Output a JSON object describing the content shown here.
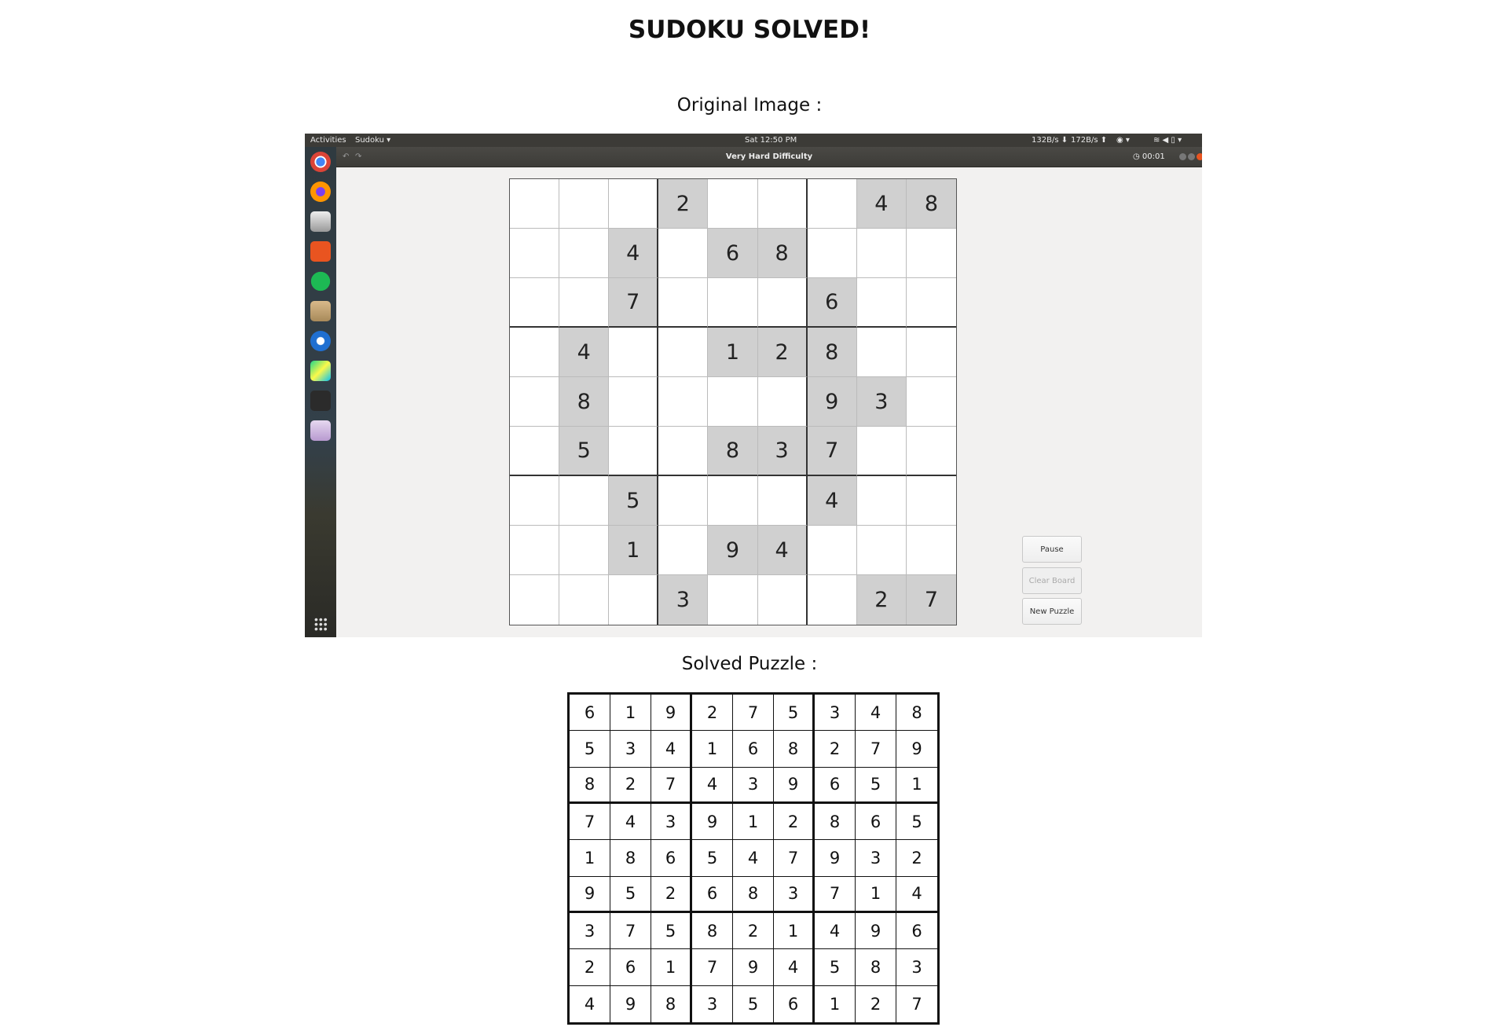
{
  "page": {
    "title": "SUDOKU SOLVED!",
    "original_label": "Original Image :",
    "solved_label": "Solved Puzzle :"
  },
  "desktop": {
    "topbar": {
      "activities": "Activities",
      "app": "Sudoku ▾",
      "clock": "Sat 12:50 PM",
      "net_down": "132B/s ⬇",
      "net_up": "172B/s ⬆"
    },
    "window": {
      "title": "Very Hard Difficulty",
      "timer": "◷ 00:01",
      "undo": "↶",
      "redo": "↷"
    },
    "dock": [
      "chrome-icon",
      "firefox-icon",
      "files-icon",
      "software-icon",
      "spotify-icon",
      "archive-icon",
      "thunderbird-icon",
      "pycharm-icon",
      "terminal-icon",
      "sudoku-icon",
      "app-grid-icon"
    ],
    "buttons": {
      "pause": "Pause",
      "clear": "Clear Board",
      "new": "New Puzzle"
    },
    "puzzle": [
      [
        "",
        "",
        "",
        "2",
        "",
        "",
        "",
        "4",
        "8"
      ],
      [
        "",
        "",
        "4",
        "",
        "6",
        "8",
        "",
        "",
        ""
      ],
      [
        "",
        "",
        "7",
        "",
        "",
        "",
        "6",
        "",
        ""
      ],
      [
        "",
        "4",
        "",
        "",
        "1",
        "2",
        "8",
        "",
        ""
      ],
      [
        "",
        "8",
        "",
        "",
        "",
        "",
        "9",
        "3",
        ""
      ],
      [
        "",
        "5",
        "",
        "",
        "8",
        "3",
        "7",
        "",
        ""
      ],
      [
        "",
        "",
        "5",
        "",
        "",
        "",
        "4",
        "",
        ""
      ],
      [
        "",
        "",
        "1",
        "",
        "9",
        "4",
        "",
        "",
        ""
      ],
      [
        "",
        "",
        "",
        "3",
        "",
        "",
        "",
        "2",
        "7"
      ]
    ]
  },
  "solution": [
    [
      "6",
      "1",
      "9",
      "2",
      "7",
      "5",
      "3",
      "4",
      "8"
    ],
    [
      "5",
      "3",
      "4",
      "1",
      "6",
      "8",
      "2",
      "7",
      "9"
    ],
    [
      "8",
      "2",
      "7",
      "4",
      "3",
      "9",
      "6",
      "5",
      "1"
    ],
    [
      "7",
      "4",
      "3",
      "9",
      "1",
      "2",
      "8",
      "6",
      "5"
    ],
    [
      "1",
      "8",
      "6",
      "5",
      "4",
      "7",
      "9",
      "3",
      "2"
    ],
    [
      "9",
      "5",
      "2",
      "6",
      "8",
      "3",
      "7",
      "1",
      "4"
    ],
    [
      "3",
      "7",
      "5",
      "8",
      "2",
      "1",
      "4",
      "9",
      "6"
    ],
    [
      "2",
      "6",
      "1",
      "7",
      "9",
      "4",
      "5",
      "8",
      "3"
    ],
    [
      "4",
      "9",
      "8",
      "3",
      "5",
      "6",
      "1",
      "2",
      "7"
    ]
  ]
}
